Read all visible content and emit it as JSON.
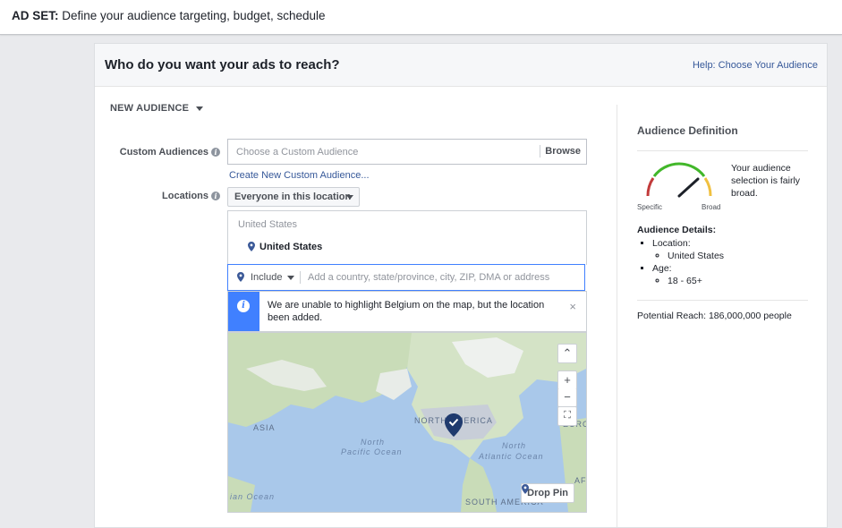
{
  "header": {
    "prefix": "AD SET:",
    "text": "Define your audience targeting, budget, schedule"
  },
  "card": {
    "title": "Who do you want your ads to reach?",
    "help_link": "Help: Choose Your Audience"
  },
  "new_audience": {
    "label": "NEW AUDIENCE"
  },
  "custom_audiences": {
    "label": "Custom Audiences",
    "placeholder": "Choose a Custom Audience",
    "browse": "Browse",
    "create_link": "Create New Custom Audience..."
  },
  "locations": {
    "label": "Locations",
    "dropdown": "Everyone in this location",
    "country_header": "United States",
    "selected": "United States",
    "include_label": "Include",
    "search_placeholder": "Add a country, state/province, city, ZIP, DMA or address"
  },
  "notice": {
    "message": "We are unable to highlight Belgium on the map, but the location been added.",
    "close": "×"
  },
  "map": {
    "labels": {
      "asia": "ASIA",
      "north_america": "NORTH AMERICA",
      "north_pacific_1": "North",
      "north_pacific_2": "Pacific Ocean",
      "north_atlantic_1": "North",
      "north_atlantic_2": "Atlantic Ocean",
      "south_america": "SOUTH AMERICA",
      "indian_ocean": "ian Ocean",
      "euro": "EURO",
      "af": "AF",
      "south": "South"
    },
    "controls": {
      "up": "⌃",
      "zoom_in": "+",
      "zoom_out": "−",
      "fullscreen": "⛶"
    },
    "drop_pin": "Drop Pin"
  },
  "audience_definition": {
    "title": "Audience Definition",
    "gauge": {
      "specific": "Specific",
      "broad": "Broad",
      "needle_level": 0.85
    },
    "description": "Your audience selection is fairly broad.",
    "details_title": "Audience Details:",
    "location_label": "Location:",
    "location_value": "United States",
    "age_label": "Age:",
    "age_value": "18 - 65+",
    "potential_reach": "Potential Reach: 186,000,000 people"
  },
  "colors": {
    "link": "#365899",
    "accent_blue": "#4080ff",
    "gauge_red": "#c23b3b",
    "gauge_green": "#42b72a",
    "gauge_yellow": "#f0c040"
  },
  "icons": [
    "info-icon",
    "pin-icon",
    "caret-down-icon",
    "close-icon",
    "map-marker-icon",
    "zoom-in-icon",
    "zoom-out-icon",
    "fullscreen-icon",
    "scroll-up-icon"
  ]
}
